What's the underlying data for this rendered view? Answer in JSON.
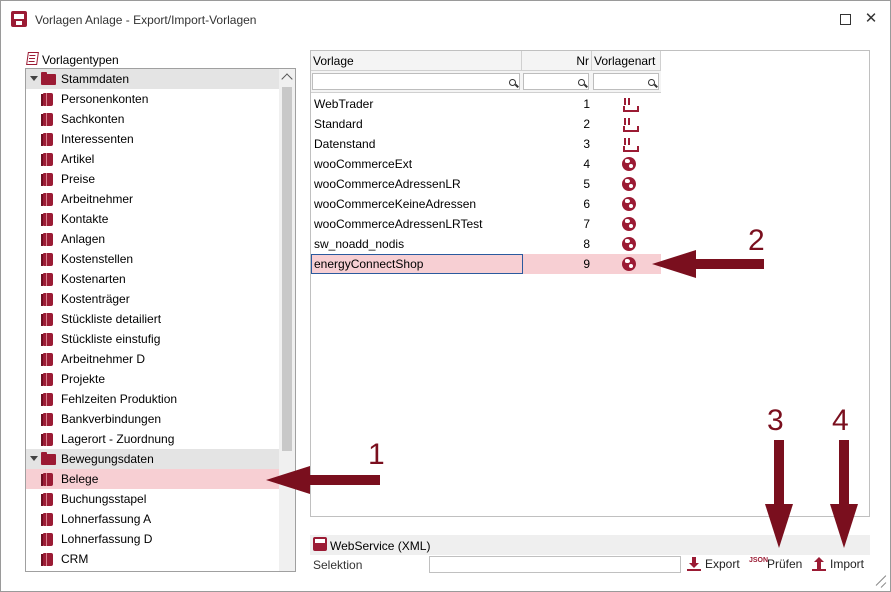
{
  "window": {
    "title": "Vorlagen Anlage - Export/Import-Vorlagen",
    "close_glyph": "✕"
  },
  "tree": {
    "header": "Vorlagentypen",
    "groups": [
      {
        "label": "Stammdaten",
        "items": [
          "Personenkonten",
          "Sachkonten",
          "Interessenten",
          "Artikel",
          "Preise",
          "Arbeitnehmer",
          "Kontakte",
          "Anlagen",
          "Kostenstellen",
          "Kostenarten",
          "Kostenträger",
          "Stückliste detailiert",
          "Stückliste einstufig",
          "Arbeitnehmer D",
          "Projekte",
          "Fehlzeiten Produktion",
          "Bankverbindungen",
          "Lagerort - Zuordnung"
        ]
      },
      {
        "label": "Bewegungsdaten",
        "items": [
          "Belege",
          "Buchungsstapel",
          "Lohnerfassung A",
          "Lohnerfassung D",
          "CRM"
        ]
      }
    ],
    "selected_item": "Belege"
  },
  "grid": {
    "columns": [
      "Vorlage",
      "Nr",
      "Vorlagenart"
    ],
    "rows": [
      {
        "name": "WebTrader",
        "nr": "1",
        "art_icon": "download-icon"
      },
      {
        "name": "Standard",
        "nr": "2",
        "art_icon": "download-icon"
      },
      {
        "name": "Datenstand",
        "nr": "3",
        "art_icon": "download-icon"
      },
      {
        "name": "wooCommerceExt",
        "nr": "4",
        "art_icon": "globe-icon"
      },
      {
        "name": "wooCommerceAdressenLR",
        "nr": "5",
        "art_icon": "globe-icon"
      },
      {
        "name": "wooCommerceKeineAdressen",
        "nr": "6",
        "art_icon": "globe-icon"
      },
      {
        "name": "wooCommerceAdressenLRTest",
        "nr": "7",
        "art_icon": "globe-icon"
      },
      {
        "name": "sw_noadd_nodis",
        "nr": "8",
        "art_icon": "globe-icon"
      },
      {
        "name": "energyConnectShop",
        "nr": "9",
        "art_icon": "globe-icon"
      }
    ],
    "selected_row": "energyConnectShop"
  },
  "bottom": {
    "webservice_label": "WebService (XML)",
    "selektion_label": "Selektion",
    "selektion_value": "",
    "export_label": "Export",
    "pruefen_label": "Prüfen",
    "pruefen_icon_text": "JSON",
    "import_label": "Import"
  },
  "annotations": [
    "1",
    "2",
    "3",
    "4"
  ],
  "colors": {
    "accent": "#9b1b34",
    "selection": "#f7cfd3",
    "arrow": "#7a0f1e"
  }
}
